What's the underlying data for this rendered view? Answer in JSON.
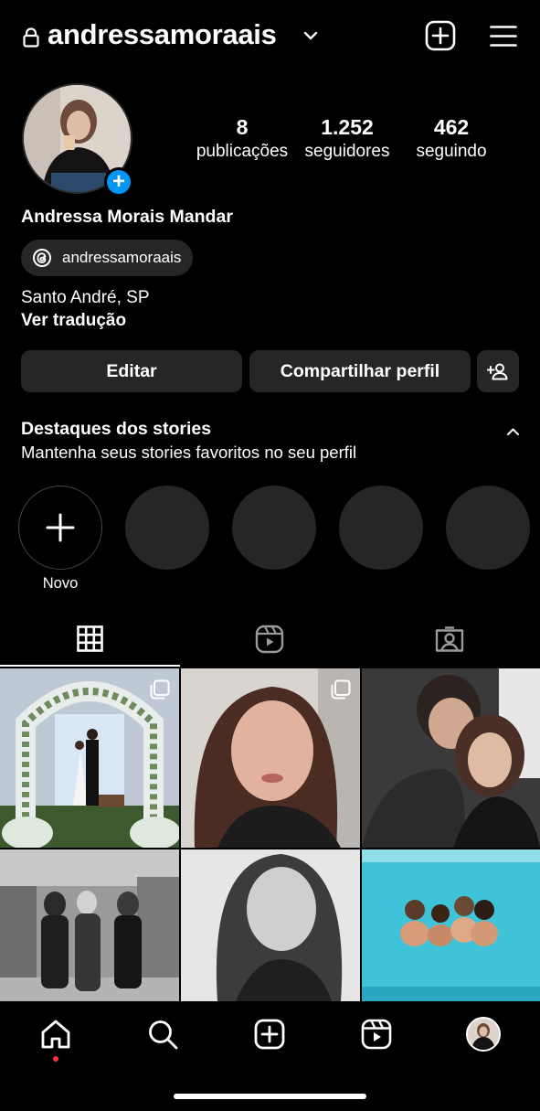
{
  "header": {
    "username": "andressamoraais",
    "icons": [
      "lock-icon",
      "chevron-down-icon",
      "new-post-icon",
      "menu-icon"
    ]
  },
  "profile": {
    "stats": [
      {
        "value": "8",
        "label": "publicações"
      },
      {
        "value": "1.252",
        "label": "seguidores"
      },
      {
        "value": "462",
        "label": "seguindo"
      }
    ],
    "name": "Andressa Morais Mandar",
    "threads_handle": "andressamoraais",
    "location": "Santo André, SP",
    "translate_label": "Ver tradução"
  },
  "actions": {
    "edit": "Editar",
    "share": "Compartilhar perfil"
  },
  "highlights": {
    "title": "Destaques dos stories",
    "subtitle": "Mantenha seus stories favoritos no seu perfil",
    "new_label": "Novo"
  },
  "tabs": [
    "grid-icon",
    "reels-icon",
    "tagged-icon"
  ],
  "bottom_nav": [
    "home-icon",
    "search-icon",
    "create-icon",
    "reels-icon",
    "profile-avatar"
  ],
  "colors": {
    "background": "#000000",
    "surface": "#262626",
    "accent": "#0095f6",
    "notification": "#ff3040"
  }
}
